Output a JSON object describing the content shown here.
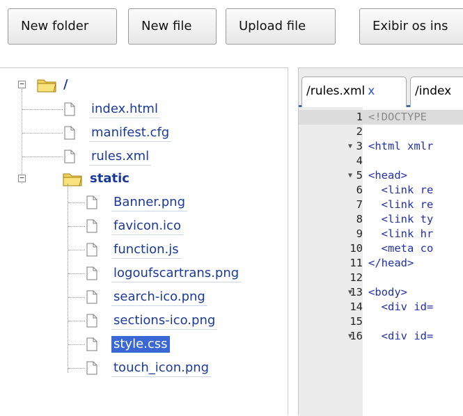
{
  "toolbar": {
    "new_folder": "New folder",
    "new_file": "New file",
    "upload_file": "Upload file",
    "exibir": "Exibir os ins"
  },
  "tree": {
    "root": "/",
    "root_files": [
      "index.html",
      "manifest.cfg",
      "rules.xml"
    ],
    "static_folder": "static",
    "static_files": [
      "Banner.png",
      "favicon.ico",
      "function.js",
      "logoufscartrans.png",
      "search-ico.png",
      "sections-ico.png",
      "style.css",
      "touch_icon.png"
    ],
    "selected": "style.css"
  },
  "editor": {
    "tabs": [
      {
        "label": "/rules.xml",
        "close": "x"
      },
      {
        "label": "/index"
      }
    ],
    "lines": [
      {
        "n": "1",
        "text": "<!DOCTYPE"
      },
      {
        "n": "2",
        "text": ""
      },
      {
        "n": "3",
        "text": "<html xmlr",
        "fold": true
      },
      {
        "n": "4",
        "text": ""
      },
      {
        "n": "5",
        "text": "<head>",
        "fold": true
      },
      {
        "n": "6",
        "text": "  <link re"
      },
      {
        "n": "7",
        "text": "  <link re"
      },
      {
        "n": "8",
        "text": "  <link ty"
      },
      {
        "n": "9",
        "text": "  <link hr"
      },
      {
        "n": "10",
        "text": "  <meta co"
      },
      {
        "n": "11",
        "text": "</head>"
      },
      {
        "n": "12",
        "text": ""
      },
      {
        "n": "13",
        "text": "<body>",
        "fold": true
      },
      {
        "n": "14",
        "text": "  <div id="
      },
      {
        "n": "15",
        "text": ""
      },
      {
        "n": "16",
        "text": "  <div id=",
        "fold": true
      }
    ]
  },
  "colors": {
    "link": "#1a3a9a",
    "selection": "#3967d4",
    "code": "#2030a8",
    "folder": "#e8c84a"
  },
  "icons": {
    "folder": "folder-open-icon",
    "file": "file-icon",
    "expander": "minus-box-icon",
    "fold": "fold-arrow-icon"
  }
}
